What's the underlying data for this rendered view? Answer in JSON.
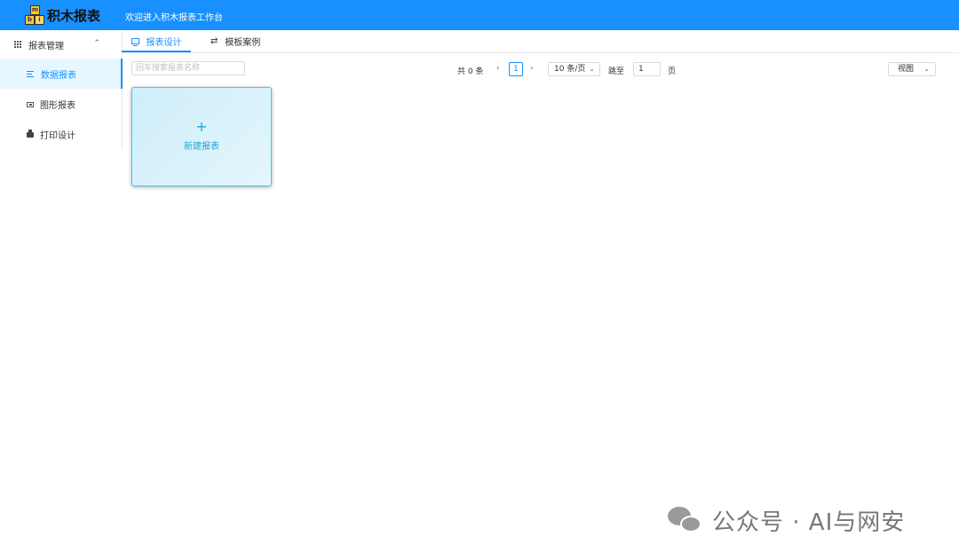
{
  "header": {
    "logo_letters": [
      "m",
      "b",
      "i"
    ],
    "logo_text": "积木报表",
    "welcome": "欢迎进入积木报表工作台"
  },
  "sidebar": {
    "group_label": "报表管理",
    "group_icon": "grid-icon",
    "group_arrow_icon": "chevron-up-icon",
    "items": [
      {
        "label": "数据报表",
        "icon": "list-icon",
        "active": true
      },
      {
        "label": "图形报表",
        "icon": "picture-icon",
        "active": false
      },
      {
        "label": "打印设计",
        "icon": "printer-icon",
        "active": false
      }
    ]
  },
  "tabs": [
    {
      "label": "报表设计",
      "icon": "monitor-icon",
      "active": true
    },
    {
      "label": "模板案例",
      "icon": "swap-icon",
      "active": false
    }
  ],
  "search": {
    "placeholder": "回车搜索报表名称"
  },
  "pagination": {
    "total_text": "共 0 条",
    "current_page": "1",
    "page_size": "10 条/页",
    "jump_label": "跳至",
    "jump_value": "1",
    "page_suffix": "页"
  },
  "view_select": {
    "value": "视图"
  },
  "new_card": {
    "plus": "+",
    "label": "新建报表"
  },
  "watermark": {
    "text": "公众号 · AI与网安",
    "icon": "wechat-icon"
  },
  "colors": {
    "primary": "#1890ff",
    "card_border": "#48c6e8",
    "card_text": "#1aa7d9"
  }
}
